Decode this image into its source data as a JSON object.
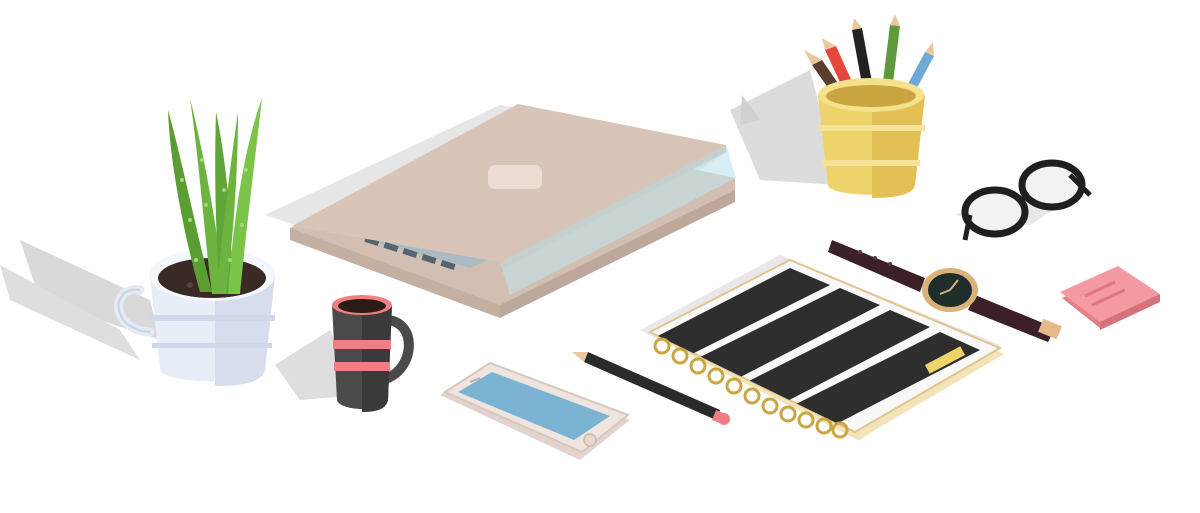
{
  "scene": {
    "objects": [
      "aloe-plant-pot-icon",
      "laptop-icon",
      "pencil-cup-icon",
      "glasses-icon",
      "wristwatch-icon",
      "sticky-notes-icon",
      "coffee-mug-icon",
      "smartphone-icon",
      "pencil-icon",
      "spiral-notebook-icon"
    ]
  },
  "colors": {
    "background": "#ffffff",
    "shadow": "#d9d9d9",
    "laptop_lid": "#d9c5b8",
    "plant_green": "#6db33f",
    "pot_white": "#e8eef8",
    "pencil_cup": "#eed26a",
    "mug_dark": "#4a4a4a",
    "accent_pink": "#f07f84",
    "phone_screen": "#7bb4d2",
    "notebook_stripe": "#2e2e2e",
    "sticky_pink": "#f49aa0"
  }
}
